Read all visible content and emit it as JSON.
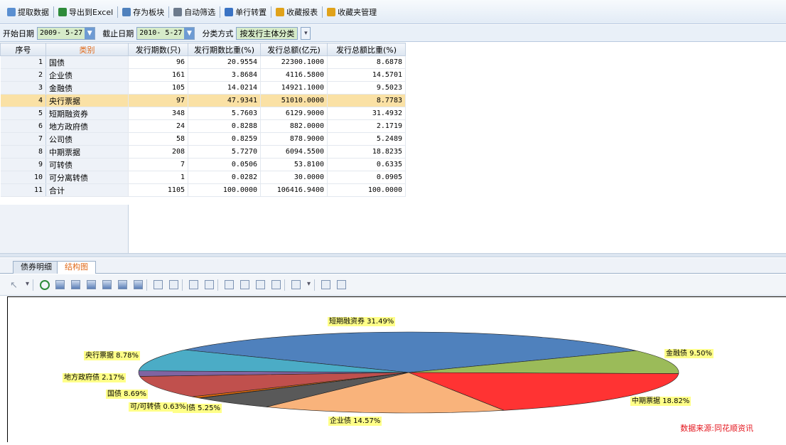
{
  "toolbar": {
    "items": [
      {
        "label": "提取数据",
        "icon": "extract-data-icon"
      },
      {
        "label": "导出到Excel",
        "icon": "excel-icon"
      },
      {
        "label": "存为板块",
        "icon": "save-block-icon"
      },
      {
        "label": "自动筛选",
        "icon": "filter-icon"
      },
      {
        "label": "单行转置",
        "icon": "transpose-icon"
      },
      {
        "label": "收藏报表",
        "icon": "favorite-report-icon"
      },
      {
        "label": "收藏夹管理",
        "icon": "favorites-manage-icon"
      }
    ]
  },
  "filters": {
    "start_label": "开始日期",
    "start_value": "2009- 5-27",
    "end_label": "截止日期",
    "end_value": "2010- 5-27",
    "class_label": "分类方式",
    "class_value": "按发行主体分类"
  },
  "table": {
    "headers": [
      "序号",
      "类别",
      "发行期数(只)",
      "发行期数比重(%)",
      "发行总额(亿元)",
      "发行总额比重(%)"
    ],
    "selected_row": 4,
    "rows": [
      [
        "1",
        "国债",
        "96",
        "20.9554",
        "22300.1000",
        "8.6878"
      ],
      [
        "2",
        "企业债",
        "161",
        "3.8684",
        "4116.5800",
        "14.5701"
      ],
      [
        "3",
        "金融债",
        "105",
        "14.0214",
        "14921.1000",
        "9.5023"
      ],
      [
        "4",
        "央行票据",
        "97",
        "47.9341",
        "51010.0000",
        "8.7783"
      ],
      [
        "5",
        "短期融资券",
        "348",
        "5.7603",
        "6129.9000",
        "31.4932"
      ],
      [
        "6",
        "地方政府债",
        "24",
        "0.8288",
        "882.0000",
        "2.1719"
      ],
      [
        "7",
        "公司债",
        "58",
        "0.8259",
        "878.9000",
        "5.2489"
      ],
      [
        "8",
        "中期票据",
        "208",
        "5.7270",
        "6094.5500",
        "18.8235"
      ],
      [
        "9",
        "可转债",
        "7",
        "0.0506",
        "53.8100",
        "0.6335"
      ],
      [
        "10",
        "可分离转债",
        "1",
        "0.0282",
        "30.0000",
        "0.0905"
      ],
      [
        "11",
        "合计",
        "1105",
        "100.0000",
        "106416.9400",
        "100.0000"
      ]
    ]
  },
  "tabs": {
    "detail": "债券明细",
    "structure": "结构图"
  },
  "chart_toolbar_icons": [
    "pointer-icon",
    "dropdown-icon",
    "refresh-icon",
    "line-chart-icon",
    "bar-chart-icon",
    "column-chart-icon",
    "area-chart-icon",
    "step-chart-icon",
    "hbar-chart-icon",
    "add-series-icon",
    "remove-series-icon",
    "swap-icon",
    "label-icon",
    "grid-icon",
    "list-icon",
    "legend-icon",
    "table-icon",
    "eraser-icon",
    "dropdown-icon",
    "window-icon",
    "restore-icon"
  ],
  "chart_data": {
    "type": "pie",
    "slices": [
      {
        "name": "短期融资券",
        "value": 31.49,
        "color": "#4f81bd",
        "label": "短期融资券 31.49%"
      },
      {
        "name": "金融债",
        "value": 9.5,
        "color": "#9bbb59",
        "label": "金融债 9.50%"
      },
      {
        "name": "中期票据",
        "value": 18.82,
        "color": "#ff3333",
        "label": "中期票据 18.82%"
      },
      {
        "name": "企业债",
        "value": 14.57,
        "color": "#f9b37b",
        "label": "企业债 14.57%"
      },
      {
        "name": "公司债",
        "value": 5.25,
        "color": "#595959",
        "label": "公司债 5.25%"
      },
      {
        "name": "可分离转债",
        "value": 0.09,
        "color": "#ffd23f",
        "label": ""
      },
      {
        "name": "可转债",
        "value": 0.63,
        "color": "#e46c0a",
        "label": "可/可转债 0.63%"
      },
      {
        "name": "国债",
        "value": 8.69,
        "color": "#c0504d",
        "label": "国债 8.69%"
      },
      {
        "name": "地方政府债",
        "value": 2.17,
        "color": "#8064a2",
        "label": "地方政府债 2.17%"
      },
      {
        "name": "央行票据",
        "value": 8.78,
        "color": "#4bacc6",
        "label": "央行票据 8.78%"
      }
    ],
    "source": "数据来源:同花顺资讯"
  }
}
